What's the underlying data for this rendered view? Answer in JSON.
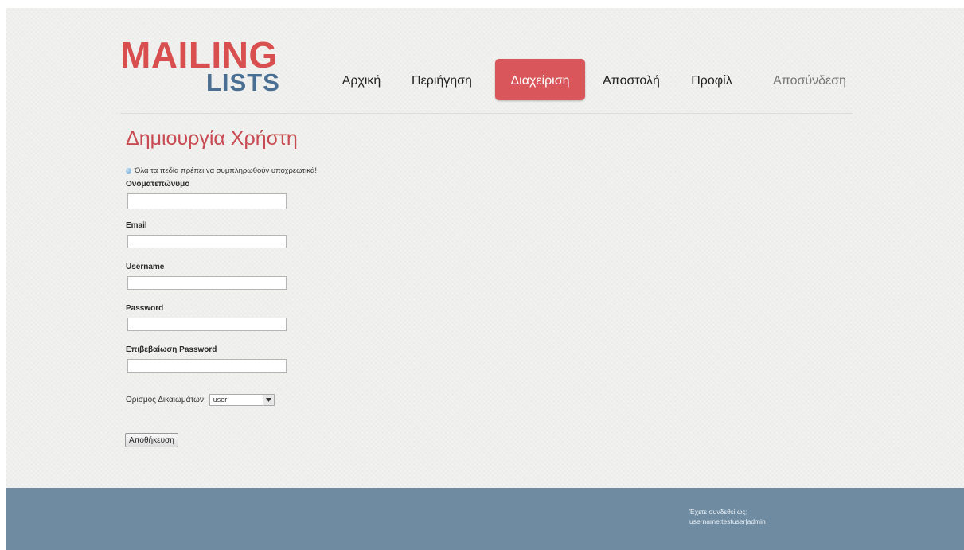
{
  "logo": {
    "line1": "MAILING",
    "line2": "LISTS"
  },
  "nav": {
    "items": [
      {
        "label": "Αρχική"
      },
      {
        "label": "Περιήγηση"
      },
      {
        "label": "Διαχείριση"
      },
      {
        "label": "Αποστολή"
      },
      {
        "label": "Προφίλ"
      },
      {
        "label": "Αποσύνδεση"
      }
    ]
  },
  "colors": {
    "brand_red": "#d94f4f",
    "brand_blue": "#4a6f92",
    "active_tab": "#d9565a",
    "title": "#c84a52",
    "footer": "#6e8ba2"
  },
  "form": {
    "title": "Δημιουργία Χρήστη",
    "notice_icon": "info-icon",
    "notice": "Όλα τα πεδία πρέπει να συμπληρωθούν υποχρεωτικά!",
    "fields": [
      {
        "label": "Ονοματεπώνυμο",
        "value": ""
      },
      {
        "label": "Email",
        "value": ""
      },
      {
        "label": "Username",
        "value": ""
      },
      {
        "label": "Password",
        "value": ""
      },
      {
        "label": "Επιβεβαίωση Password",
        "value": ""
      }
    ],
    "role": {
      "label": "Ορισμός Δικαιωμάτων:",
      "selected": "user"
    },
    "submit_label": "Αποθήκευση"
  },
  "footer": {
    "status_line1": "Έχετε συνδεθεί ως:",
    "status_line2": "username:testuser|admin"
  }
}
